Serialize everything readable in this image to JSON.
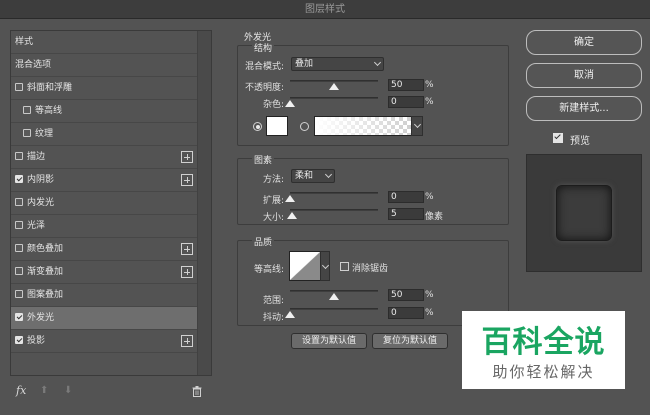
{
  "window": {
    "title": "图层样式"
  },
  "left_panel": {
    "items": [
      {
        "label": "样式",
        "checkbox": false,
        "checked": false,
        "plus": false,
        "selected": false,
        "sub": false
      },
      {
        "label": "混合选项",
        "checkbox": false,
        "checked": false,
        "plus": false,
        "selected": false,
        "sub": false
      },
      {
        "label": "斜面和浮雕",
        "checkbox": true,
        "checked": false,
        "plus": false,
        "selected": false,
        "sub": false
      },
      {
        "label": "等高线",
        "checkbox": true,
        "checked": false,
        "plus": false,
        "selected": false,
        "sub": true
      },
      {
        "label": "纹理",
        "checkbox": true,
        "checked": false,
        "plus": false,
        "selected": false,
        "sub": true
      },
      {
        "label": "描边",
        "checkbox": true,
        "checked": false,
        "plus": true,
        "selected": false,
        "sub": false
      },
      {
        "label": "内阴影",
        "checkbox": true,
        "checked": true,
        "plus": true,
        "selected": false,
        "sub": false
      },
      {
        "label": "内发光",
        "checkbox": true,
        "checked": false,
        "plus": false,
        "selected": false,
        "sub": false
      },
      {
        "label": "光泽",
        "checkbox": true,
        "checked": false,
        "plus": false,
        "selected": false,
        "sub": false
      },
      {
        "label": "颜色叠加",
        "checkbox": true,
        "checked": false,
        "plus": true,
        "selected": false,
        "sub": false
      },
      {
        "label": "渐变叠加",
        "checkbox": true,
        "checked": false,
        "plus": true,
        "selected": false,
        "sub": false
      },
      {
        "label": "图案叠加",
        "checkbox": true,
        "checked": false,
        "plus": false,
        "selected": false,
        "sub": false
      },
      {
        "label": "外发光",
        "checkbox": true,
        "checked": true,
        "plus": false,
        "selected": true,
        "sub": false
      },
      {
        "label": "投影",
        "checkbox": true,
        "checked": true,
        "plus": true,
        "selected": false,
        "sub": false
      }
    ],
    "footer": {
      "fx": "fx",
      "up": "⬆",
      "down": "⬇"
    }
  },
  "outer_glow": {
    "title": "外发光",
    "structure": {
      "title": "结构",
      "blend_mode_label": "混合模式:",
      "blend_mode_value": "叠加",
      "opacity_label": "不透明度:",
      "opacity_value": "50",
      "opacity_unit": "%",
      "opacity_level": 50,
      "noise_label": "杂色:",
      "noise_value": "0",
      "noise_unit": "%",
      "noise_level": 0,
      "color_mode": "solid"
    },
    "elements": {
      "title": "图素",
      "method_label": "方法:",
      "method_value": "柔和",
      "spread_label": "扩展:",
      "spread_value": "0",
      "spread_unit": "%",
      "spread_level": 0,
      "size_label": "大小:",
      "size_value": "5",
      "size_unit": "像素",
      "size_level": 2
    },
    "quality": {
      "title": "品质",
      "contour_label": "等高线:",
      "antialias_label": "消除锯齿",
      "antialias_checked": false,
      "range_label": "范围:",
      "range_value": "50",
      "range_unit": "%",
      "range_level": 50,
      "jitter_label": "抖动:",
      "jitter_value": "0",
      "jitter_unit": "%",
      "jitter_level": 0
    },
    "buttons": {
      "set_default": "设置为默认值",
      "reset_default": "复位为默认值"
    }
  },
  "right_panel": {
    "ok": "确定",
    "cancel": "取消",
    "new_style": "新建样式...",
    "preview_label": "预览",
    "preview_checked": true
  },
  "watermark": {
    "title": "百科全说",
    "subtitle": "助你轻松解决"
  },
  "colors": {
    "dialog_bg": "#535353",
    "selected_row": "#6e6e6e",
    "watermark_green": "#1aa561"
  }
}
